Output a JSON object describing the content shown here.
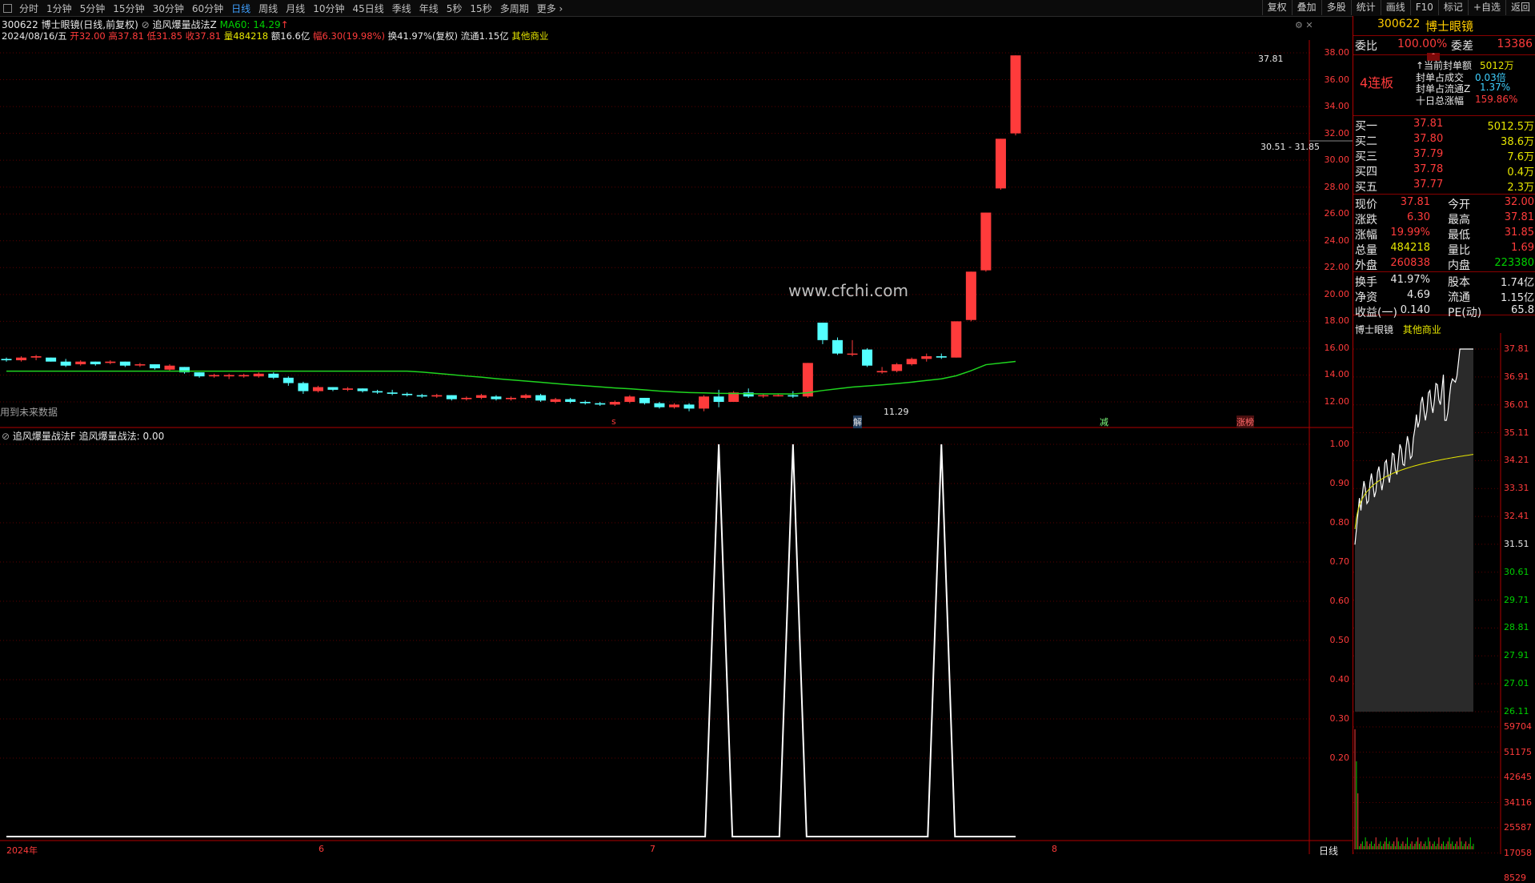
{
  "toolbar": {
    "tabs": [
      "分时",
      "1分钟",
      "5分钟",
      "15分钟",
      "30分钟",
      "60分钟",
      "日线",
      "周线",
      "月线",
      "10分钟",
      "45日线",
      "季线",
      "年线",
      "5秒",
      "15秒",
      "多周期",
      "更多 ›"
    ],
    "active_tab": "日线",
    "buttons": [
      "复权",
      "叠加",
      "多股",
      "统计",
      "画线",
      "F10",
      "标记",
      "+自选",
      "返回"
    ]
  },
  "header": {
    "code_name": "300622 博士眼镜(日线,前复权)",
    "indicator": "追风爆量战法Z",
    "ma_label": "MA60: 14.29",
    "date": "2024/08/16/五",
    "open": "开32.00",
    "high": "高37.81",
    "low": "低31.85",
    "close": "收37.81",
    "vol": "量484218",
    "amount": "额16.6亿",
    "change": "幅6.30(19.98%)",
    "turnover": "换41.97%(复权)",
    "float": "流通1.15亿",
    "sector": "其他商业"
  },
  "chart_text": {
    "watermark": "www.cfchi.com",
    "future_note": "用到未来数据",
    "high_label": "37.81",
    "range_label": "30.51 - 31.85",
    "low_label": "11.29",
    "marker_s": "s",
    "marker_jie": "解",
    "marker_jian": "减",
    "marker_zb": "涨榜"
  },
  "sub_header": {
    "name": "追风爆量战法F",
    "label": "追风爆量战法:",
    "value": "0.00"
  },
  "x_axis": [
    "2024年",
    "6",
    "7",
    "8"
  ],
  "period_badge": "日线",
  "price_axis": [
    "38.00",
    "36.00",
    "34.00",
    "32.00",
    "30.00",
    "28.00",
    "26.00",
    "24.00",
    "22.00",
    "20.00",
    "18.00",
    "16.00",
    "14.00",
    "12.00"
  ],
  "sub_axis": [
    "1.00",
    "0.90",
    "0.80",
    "0.70",
    "0.60",
    "0.50",
    "0.40",
    "0.30",
    "0.20"
  ],
  "right_panel": {
    "stock_code": "300622",
    "stock_name": "博士眼镜",
    "weibi_label": "委比",
    "weibi_value": "100.00%",
    "weicha_label": "委差",
    "weicha_value": "13386",
    "streak": "4连板",
    "seal_rows": [
      {
        "label": "↑当前封单额",
        "value": "5012万"
      },
      {
        "label": "封单占成交",
        "value": "0.03倍"
      },
      {
        "label": "封单占流通Z",
        "value": "1.37%"
      },
      {
        "label": "十日总涨幅",
        "value": "159.86%"
      }
    ],
    "bids": [
      {
        "label": "买一",
        "price": "37.81",
        "vol": "5012.5万"
      },
      {
        "label": "买二",
        "price": "37.80",
        "vol": "38.6万"
      },
      {
        "label": "买三",
        "price": "37.79",
        "vol": "7.6万"
      },
      {
        "label": "买四",
        "price": "37.78",
        "vol": "0.4万"
      },
      {
        "label": "买五",
        "price": "37.77",
        "vol": "2.3万"
      }
    ],
    "quote_rows": [
      {
        "l1": "现价",
        "v1": "37.81",
        "l2": "今开",
        "v2": "32.00"
      },
      {
        "l1": "涨跌",
        "v1": "6.30",
        "l2": "最高",
        "v2": "37.81"
      },
      {
        "l1": "涨幅",
        "v1": "19.99%",
        "l2": "最低",
        "v2": "31.85"
      },
      {
        "l1": "总量",
        "v1": "484218",
        "l2": "量比",
        "v2": "1.69"
      },
      {
        "l1": "外盘",
        "v1": "260838",
        "l2": "内盘",
        "v2": "223380"
      }
    ],
    "stats_rows": [
      {
        "l1": "换手",
        "v1": "41.97%",
        "l2": "股本",
        "v2": "1.74亿"
      },
      {
        "l1": "净资",
        "v1": "4.69",
        "l2": "流通",
        "v2": "1.15亿"
      },
      {
        "l1": "收益(一)",
        "v1": "0.140",
        "l2": "PE(动)",
        "v2": "65.8"
      }
    ],
    "mini_name": "博士眼镜",
    "mini_sector": "其他商业",
    "mini_axis": [
      "37.81",
      "36.91",
      "36.01",
      "35.11",
      "34.21",
      "33.31",
      "32.41",
      "31.51",
      "30.61",
      "29.71",
      "28.81",
      "27.91",
      "27.01",
      "26.11"
    ],
    "mini_vol_axis": [
      "59704",
      "51175",
      "42645",
      "34116",
      "25587",
      "17058",
      "8529"
    ]
  },
  "colors": {
    "up": "#ff3b3b",
    "down": "#54ffff",
    "ma": "#1fd41f",
    "panel_border": "#b00000"
  }
}
